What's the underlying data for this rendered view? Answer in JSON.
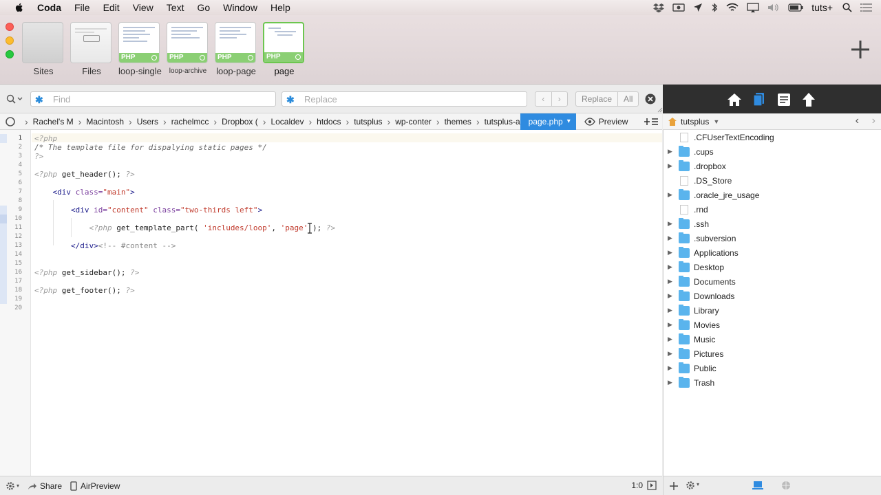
{
  "menubar": {
    "app_name": "Coda",
    "items": [
      "File",
      "Edit",
      "View",
      "Text",
      "Go",
      "Window",
      "Help"
    ],
    "user": "tuts+"
  },
  "tabs": [
    {
      "label": "Sites",
      "type": "sites"
    },
    {
      "label": "Files",
      "type": "files"
    },
    {
      "label": "loop-single",
      "badge": "PHP"
    },
    {
      "label": "loop-archive",
      "badge": "PHP"
    },
    {
      "label": "loop-page",
      "badge": "PHP"
    },
    {
      "label": "page",
      "badge": "PHP",
      "active": true
    }
  ],
  "find": {
    "find_placeholder": "Find",
    "replace_placeholder": "Replace",
    "replace_label": "Replace",
    "all_label": "All"
  },
  "path": {
    "crumbs": [
      "Rachel's M",
      "Macintosh",
      "Users",
      "rachelmcc",
      "Dropbox (",
      "Localdev",
      "htdocs",
      "tutsplus",
      "wp-conter",
      "themes",
      "tutsplus-a"
    ],
    "current_file": "page.php",
    "preview_label": "Preview"
  },
  "editor": {
    "current_line": 1,
    "line_count": 20
  },
  "browser": {
    "current_folder": "tutsplus",
    "items": [
      {
        "name": ".CFUserTextEncoding",
        "kind": "file"
      },
      {
        "name": ".cups",
        "kind": "folder"
      },
      {
        "name": ".dropbox",
        "kind": "folder"
      },
      {
        "name": ".DS_Store",
        "kind": "file"
      },
      {
        "name": ".oracle_jre_usage",
        "kind": "folder"
      },
      {
        "name": ".rnd",
        "kind": "file"
      },
      {
        "name": ".ssh",
        "kind": "folder"
      },
      {
        "name": ".subversion",
        "kind": "folder"
      },
      {
        "name": "Applications",
        "kind": "folder"
      },
      {
        "name": "Desktop",
        "kind": "folder"
      },
      {
        "name": "Documents",
        "kind": "folder"
      },
      {
        "name": "Downloads",
        "kind": "folder"
      },
      {
        "name": "Library",
        "kind": "folder"
      },
      {
        "name": "Movies",
        "kind": "folder"
      },
      {
        "name": "Music",
        "kind": "folder"
      },
      {
        "name": "Pictures",
        "kind": "folder"
      },
      {
        "name": "Public",
        "kind": "folder"
      },
      {
        "name": "Trash",
        "kind": "folder"
      }
    ]
  },
  "status": {
    "share_label": "Share",
    "airpreview_label": "AirPreview",
    "position": "1:0"
  },
  "colors": {
    "accent": "#2f8be0",
    "tab_active": "#6cc64f",
    "folder": "#5ab4ed"
  }
}
